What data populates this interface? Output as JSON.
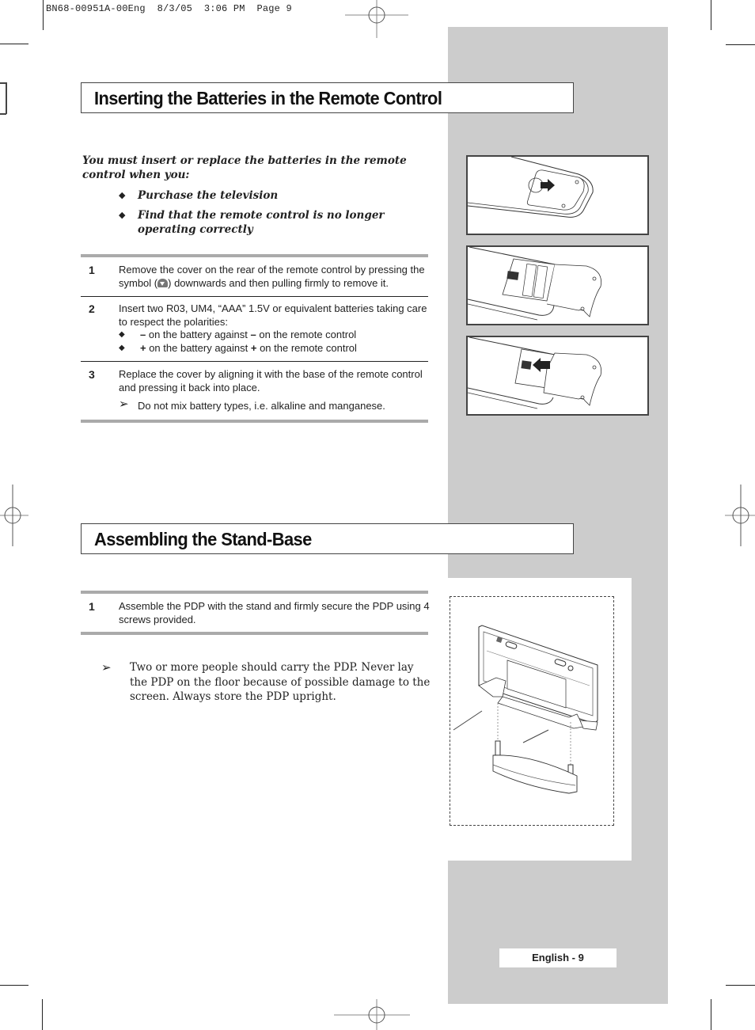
{
  "print_slug": "BN68-00951A-00Eng  8/3/05  3:06 PM  Page 9",
  "section_batteries": {
    "title": "Inserting the Batteries in the Remote Control",
    "intro": "You must insert or replace the batteries in the remote control when you:",
    "bullets": [
      "Purchase the television",
      "Find that the remote control is no longer operating correctly"
    ],
    "bullet_glyph": "◆",
    "steps": [
      {
        "number": "1",
        "text_before_symbol": "Remove the cover on the rear of the remote control by pressing the symbol (",
        "symbol_icon": "press-down-arrow-icon",
        "text_after_symbol": ") downwards and then pulling firmly to remove it."
      },
      {
        "number": "2",
        "text": "Insert two R03, UM4, “AAA” 1.5V or equivalent batteries taking care to respect the polarities:",
        "sub_items": [
          {
            "sign": "–",
            "text_mid": " on the battery against ",
            "sign2": "–",
            "text_end": " on the remote control"
          },
          {
            "sign": "+",
            "text_mid": " on the battery against ",
            "sign2": "+",
            "text_end": " on the remote control"
          }
        ]
      },
      {
        "number": "3",
        "text": "Replace the cover by aligning it with the base of the remote control and pressing it back into place.",
        "note": "Do not mix battery types, i.e. alkaline and manganese."
      }
    ],
    "illustrations": [
      "remote-cover-removal",
      "remote-batteries-inserted",
      "remote-cover-replacement"
    ]
  },
  "section_stand": {
    "title": "Assembling the Stand-Base",
    "steps": [
      {
        "number": "1",
        "text": "Assemble the PDP with the stand and firmly secure the PDP using 4 screws provided."
      }
    ],
    "note": "Two or more people should carry the PDP. Never lay the PDP on the floor because of possible damage to the screen. Always store the PDP upright.",
    "illustration": "pdp-stand-assembly"
  },
  "note_glyph": "➢",
  "page_label": "English - 9",
  "colors": {
    "sidebar_gray": "#cccccc",
    "rule_gray": "#aaaaaa",
    "text": "#222222"
  }
}
